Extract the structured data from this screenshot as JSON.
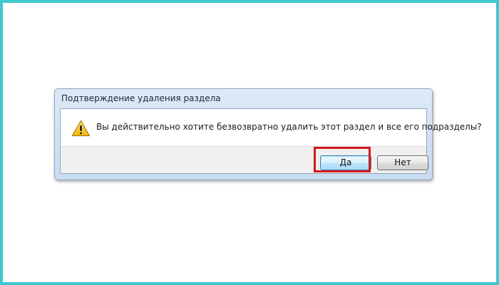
{
  "dialog": {
    "title": "Подтверждение удаления раздела",
    "icon": "warning-icon",
    "message": "Вы действительно хотите безвозвратно удалить этот раздел и все его подразделы?",
    "buttons": {
      "yes_label": "Да",
      "no_label": "Нет"
    }
  },
  "colors": {
    "page_border": "#3ec7cf",
    "highlight": "#d6191e"
  }
}
